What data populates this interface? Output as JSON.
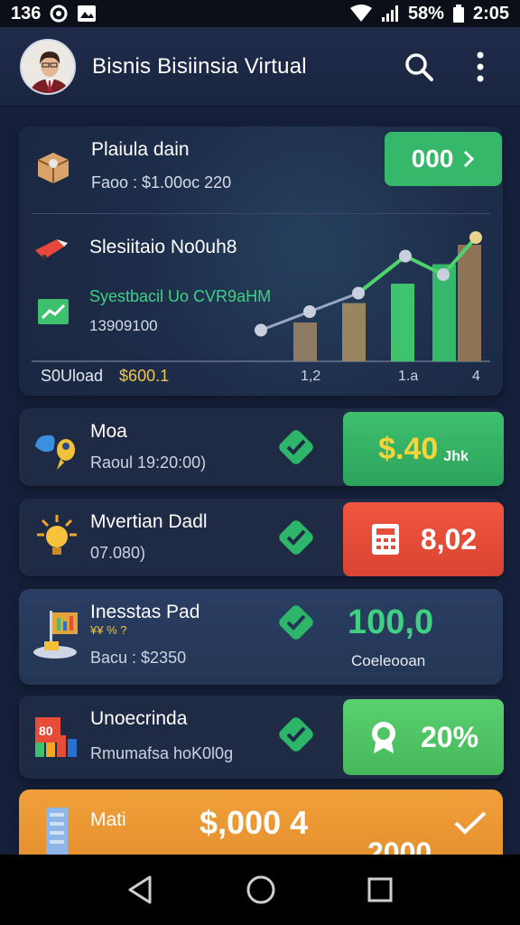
{
  "status_bar": {
    "time_left": "136",
    "battery": "58%",
    "time": "2:05"
  },
  "app_bar": {
    "title": "Bisnis Bisiinsia Virtual"
  },
  "hero": {
    "title": "Plaiula dain",
    "subtitle": "Faoo : $1.00oc 220",
    "button_label": "000",
    "row2_label": "Slesiitaio No0uh8",
    "row3_label": "Syestbacil Uo CVR9aHM",
    "row3_value": "13909100",
    "footer_label": "S0Uload",
    "footer_value": "$600.1",
    "axis_ticks": [
      "1,2",
      "1.a",
      "4"
    ]
  },
  "chart_data": {
    "type": "line",
    "series": [
      {
        "values": [
          1,
          2,
          3,
          5,
          4,
          6
        ]
      }
    ],
    "bars": [
      2,
      3,
      4,
      5,
      6
    ],
    "ticks": [
      "1,2",
      "1.a",
      "4"
    ]
  },
  "cards": [
    {
      "title": "Moa",
      "subtitle": "Raoul 19:20:00)",
      "action_value": "$.40",
      "action_note": "Jhk",
      "action_color": "#36b767"
    },
    {
      "title": "Mvertian Dadl",
      "subtitle": "07.080)",
      "action_value": "8,02",
      "action_color": "#e64c38"
    },
    {
      "title": "Inesstas Pad",
      "subtitle_small": "¥¥ % ?",
      "subtitle": "Bacu : $2350",
      "action_value": "100,0",
      "action_note": "Coeleooan"
    },
    {
      "title": "Unoecrinda",
      "subtitle": "Rmumafsa hoK0l0g",
      "action_value": "20%",
      "action_color": "#4fc566"
    },
    {
      "title": "Mati",
      "value": "$,000 4",
      "partial_value": "2000"
    }
  ],
  "colors": {
    "accent_green": "#35b86a",
    "accent_red": "#e64c38",
    "accent_orange": "#ee9a36",
    "background": "#16203a"
  },
  "icons": [
    "avatar",
    "search-icon",
    "more-vert-icon",
    "check-icon",
    "back-icon",
    "home-icon",
    "recents-icon"
  ]
}
